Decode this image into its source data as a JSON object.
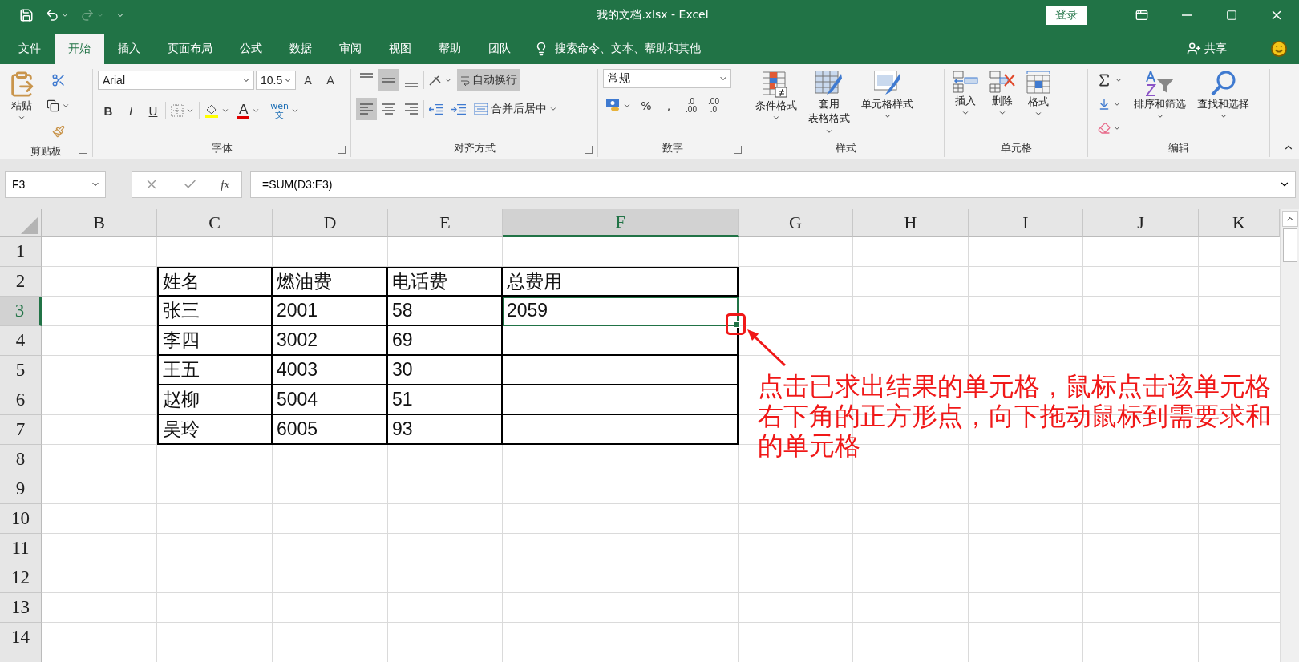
{
  "title_bar": {
    "title": "我的文档.xlsx  -  Excel",
    "login_button": "登录"
  },
  "menu_tabs": [
    {
      "label": "文件",
      "selected": false
    },
    {
      "label": "开始",
      "selected": true
    },
    {
      "label": "插入",
      "selected": false
    },
    {
      "label": "页面布局",
      "selected": false
    },
    {
      "label": "公式",
      "selected": false
    },
    {
      "label": "数据",
      "selected": false
    },
    {
      "label": "审阅",
      "selected": false
    },
    {
      "label": "视图",
      "selected": false
    },
    {
      "label": "帮助",
      "selected": false
    },
    {
      "label": "团队",
      "selected": false
    }
  ],
  "tell_me": "搜索命令、文本、帮助和其他",
  "share": "共享",
  "ribbon": {
    "clipboard": {
      "label": "剪贴板",
      "paste": "粘贴"
    },
    "font": {
      "label": "字体",
      "font_name": "Arial",
      "font_size": "10.5",
      "grow": "A",
      "shrink": "A",
      "bold": "B",
      "italic": "I",
      "underline": "U",
      "font_color": "A",
      "phonetic": [
        "wén",
        "文"
      ]
    },
    "alignment": {
      "label": "对齐方式",
      "vertical": [
        {
          "kind": "top",
          "selected": false
        },
        {
          "kind": "middle",
          "selected": true
        },
        {
          "kind": "bottom",
          "selected": false
        }
      ],
      "horizontal": [
        {
          "kind": "left",
          "selected": true
        },
        {
          "kind": "center",
          "selected": false
        },
        {
          "kind": "right",
          "selected": false
        }
      ],
      "wrap_text": {
        "label": "自动换行",
        "selected": true
      },
      "merge": "合并后居中"
    },
    "number": {
      "label": "数字",
      "format": "常规",
      "percent": "%",
      "comma": ",",
      "increase_decimal": [
        ".0",
        ".00"
      ],
      "decrease_decimal": [
        ".00",
        ".0"
      ]
    },
    "styles": {
      "label": "样式",
      "buttons": [
        {
          "kind": "conditional",
          "lines": [
            "条件格式"
          ]
        },
        {
          "kind": "table",
          "lines": [
            "套用",
            "表格格式"
          ]
        },
        {
          "kind": "cell",
          "lines": [
            "单元格样式"
          ]
        }
      ]
    },
    "cells": {
      "label": "单元格",
      "buttons": [
        {
          "kind": "insert",
          "label": "插入"
        },
        {
          "kind": "delete",
          "label": "删除"
        },
        {
          "kind": "format",
          "label": "格式"
        }
      ]
    },
    "editing": {
      "label": "编辑",
      "buttons": [
        {
          "kind": "sort",
          "label": "排序和筛选"
        },
        {
          "kind": "find",
          "label": "查找和选择"
        }
      ]
    }
  },
  "formula_bar": {
    "name_box": "F3",
    "insert_function": "fx",
    "formula": "=SUM(D3:E3)"
  },
  "sheet": {
    "columns": [
      {
        "label": "B",
        "selected": false
      },
      {
        "label": "C",
        "selected": false
      },
      {
        "label": "D",
        "selected": false
      },
      {
        "label": "E",
        "selected": false
      },
      {
        "label": "F",
        "selected": true
      },
      {
        "label": "G",
        "selected": false
      },
      {
        "label": "H",
        "selected": false
      },
      {
        "label": "I",
        "selected": false
      },
      {
        "label": "J",
        "selected": false
      },
      {
        "label": "K",
        "selected": false
      }
    ],
    "rows": [
      {
        "label": "1",
        "selected": false
      },
      {
        "label": "2",
        "selected": false
      },
      {
        "label": "3",
        "selected": true
      },
      {
        "label": "4",
        "selected": false
      },
      {
        "label": "5",
        "selected": false
      },
      {
        "label": "6",
        "selected": false
      },
      {
        "label": "7",
        "selected": false
      },
      {
        "label": "8",
        "selected": false
      },
      {
        "label": "9",
        "selected": false
      },
      {
        "label": "10",
        "selected": false
      },
      {
        "label": "11",
        "selected": false
      },
      {
        "label": "12",
        "selected": false
      },
      {
        "label": "13",
        "selected": false
      },
      {
        "label": "14",
        "selected": false
      }
    ]
  },
  "table": {
    "header": [
      "姓名",
      "燃油费",
      "电话费",
      "总费用"
    ],
    "rows": [
      {
        "cells": [
          {
            "text": "张三",
            "selected": false
          },
          {
            "text": "2001",
            "selected": false
          },
          {
            "text": "58",
            "selected": false
          },
          {
            "text": "2059",
            "selected": true
          }
        ]
      },
      {
        "cells": [
          {
            "text": "李四",
            "selected": false
          },
          {
            "text": "3002",
            "selected": false
          },
          {
            "text": "69",
            "selected": false
          }
        ]
      },
      {
        "cells": [
          {
            "text": "王五",
            "selected": false
          },
          {
            "text": "4003",
            "selected": false
          },
          {
            "text": "30",
            "selected": false
          }
        ]
      },
      {
        "cells": [
          {
            "text": "赵柳",
            "selected": false
          },
          {
            "text": "5004",
            "selected": false
          },
          {
            "text": "51",
            "selected": false
          }
        ]
      },
      {
        "cells": [
          {
            "text": "吴玲",
            "selected": false
          },
          {
            "text": "6005",
            "selected": false
          },
          {
            "text": "93",
            "selected": false
          }
        ]
      }
    ]
  },
  "annotation": "点击已求出结果的单元格，鼠标点击该单元格右下角的正方形点，向下拖动鼠标到需要求和的单元格"
}
